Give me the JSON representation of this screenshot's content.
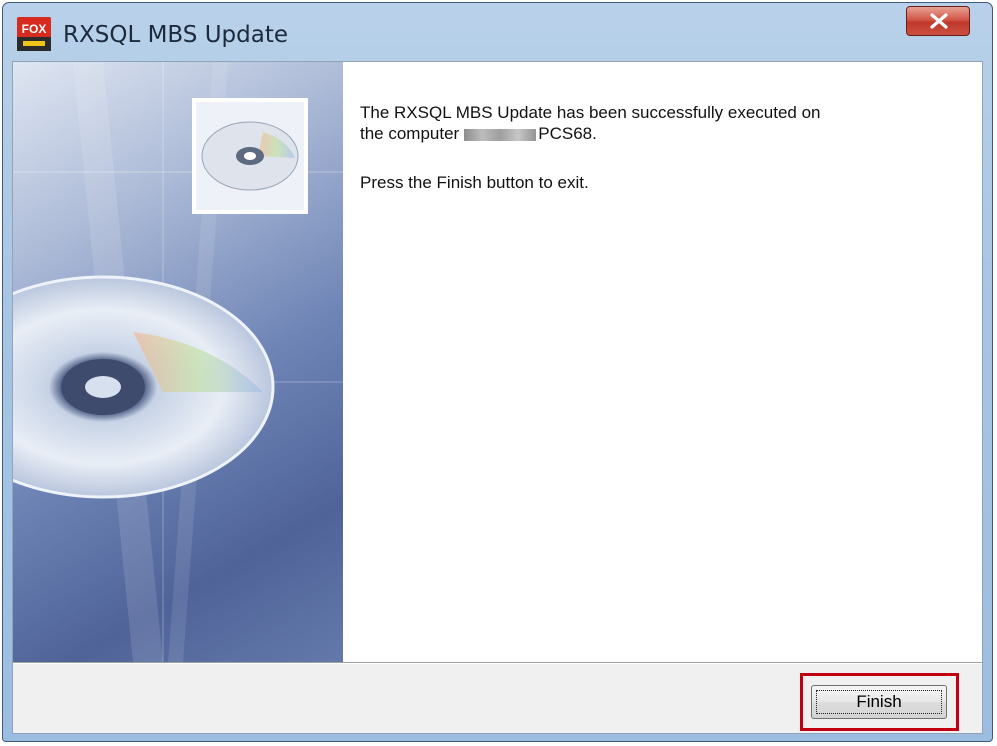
{
  "window": {
    "title": "RXSQL MBS Update",
    "app_icon": "fox-logo-icon",
    "close_icon": "close-icon"
  },
  "side_panel": {
    "image": "cd-disc-illustration",
    "icon": "cd-disc-icon"
  },
  "content": {
    "message_line1": "The RXSQL MBS Update has been successfully executed on",
    "message_line2_prefix": "the computer",
    "computer_name_suffix": "PCS68.",
    "instruction": "Press the Finish button to exit."
  },
  "footer": {
    "finish_label": "Finish"
  },
  "colors": {
    "titlebar": "#a8c5e3",
    "close_button": "#c0392b",
    "highlight": "#c00010"
  }
}
